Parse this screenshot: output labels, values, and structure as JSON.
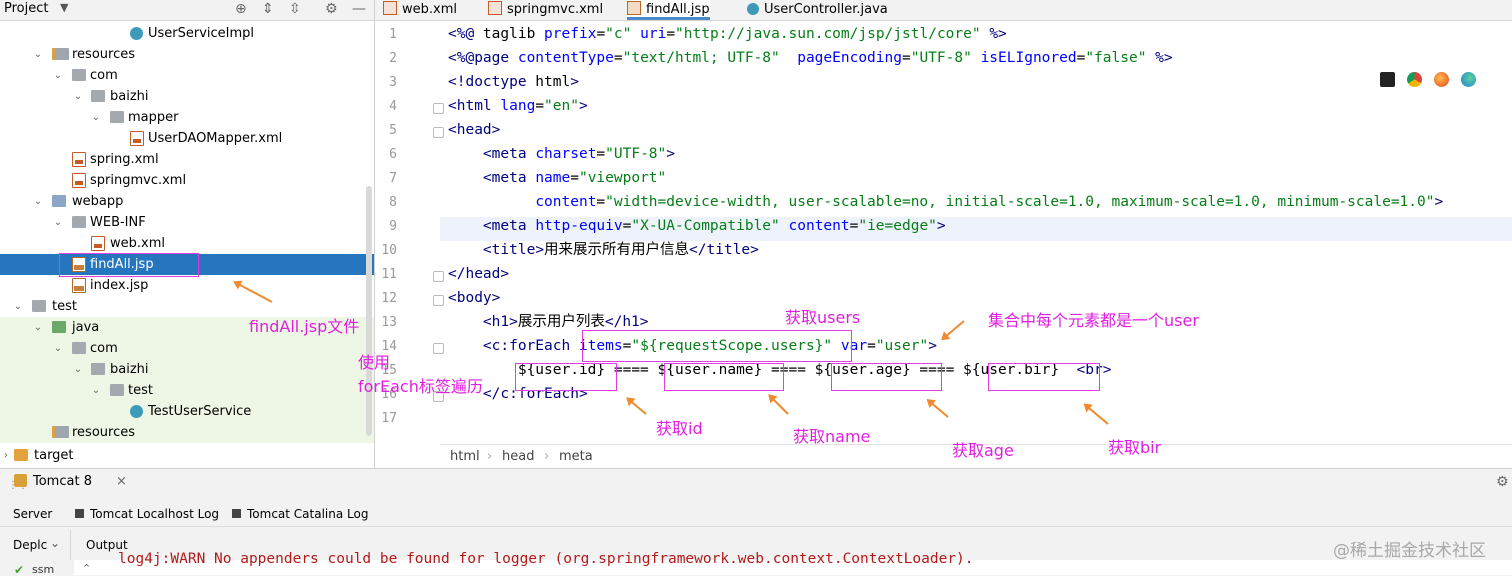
{
  "project_panel": {
    "title": "Project",
    "tree": [
      {
        "label": "UserServiceImpl",
        "icon": "class-icon"
      },
      {
        "label": "resources",
        "icon": "resources-folder-icon"
      },
      {
        "label": "com",
        "icon": "folder-icon"
      },
      {
        "label": "baizhi",
        "icon": "folder-icon"
      },
      {
        "label": "mapper",
        "icon": "folder-icon"
      },
      {
        "label": "UserDAOMapper.xml",
        "icon": "xml-file-icon"
      },
      {
        "label": "spring.xml",
        "icon": "xml-file-icon"
      },
      {
        "label": "springmvc.xml",
        "icon": "xml-file-icon"
      },
      {
        "label": "webapp",
        "icon": "web-folder-icon"
      },
      {
        "label": "WEB-INF",
        "icon": "folder-icon"
      },
      {
        "label": "web.xml",
        "icon": "xml-file-icon"
      },
      {
        "label": "findAll.jsp",
        "icon": "jsp-file-icon",
        "selected": true
      },
      {
        "label": "index.jsp",
        "icon": "jsp-file-icon"
      },
      {
        "label": "test",
        "icon": "folder-icon"
      },
      {
        "label": "java",
        "icon": "test-source-folder-icon"
      },
      {
        "label": "com",
        "icon": "folder-icon"
      },
      {
        "label": "baizhi",
        "icon": "folder-icon"
      },
      {
        "label": "test",
        "icon": "folder-icon"
      },
      {
        "label": "TestUserService",
        "icon": "class-icon"
      },
      {
        "label": "resources",
        "icon": "resources-folder-icon"
      },
      {
        "label": "target",
        "icon": "target-folder-icon"
      }
    ]
  },
  "editor_tabs": [
    {
      "label": "web.xml",
      "icon": "xml-file-icon"
    },
    {
      "label": "springmvc.xml",
      "icon": "xml-file-icon"
    },
    {
      "label": "findAll.jsp",
      "icon": "jsp-file-icon",
      "active": true
    },
    {
      "label": "UserController.java",
      "icon": "class-icon"
    }
  ],
  "line_numbers": [
    "1",
    "2",
    "3",
    "4",
    "5",
    "6",
    "7",
    "8",
    "9",
    "10",
    "11",
    "12",
    "13",
    "14",
    "15",
    "16",
    "17"
  ],
  "code_lines": [
    "<%@ taglib prefix=\"c\" uri=\"http://java.sun.com/jsp/jstl/core\" %>",
    "<%@page contentType=\"text/html; UTF-8\"  pageEncoding=\"UTF-8\" isELIgnored=\"false\" %>",
    "<!doctype html>",
    "<html lang=\"en\">",
    "<head>",
    "    <meta charset=\"UTF-8\">",
    "    <meta name=\"viewport\"",
    "          content=\"width=device-width, user-scalable=no, initial-scale=1.0, maximum-scale=1.0, minimum-scale=1.0\">",
    "    <meta http-equiv=\"X-UA-Compatible\" content=\"ie=edge\">",
    "    <title>用来展示所有用户信息</title>",
    "</head>",
    "<body>",
    "    <h1>展示用户列表</h1>",
    "    <c:forEach items=\"${requestScope.users}\" var=\"user\">",
    "        ${user.id} ==== ${user.name} ==== ${user.age} ==== ${user.bir}  <br>",
    "    </c:forEach>",
    ""
  ],
  "breadcrumb": [
    "html",
    "head",
    "meta"
  ],
  "bottom_panel": {
    "run_tab": "Tomcat 8",
    "tabs": [
      "Server",
      "Tomcat Localhost Log",
      "Tomcat Catalina Log"
    ],
    "deploy_label": "Deplc",
    "output_label": "Output",
    "log_line": "log4j:WARN No appenders could be found for logger (org.springframework.web.context.ContextLoader)."
  },
  "annotations": {
    "findall_file": "findAll.jsp文件",
    "use_foreach_1": "使用",
    "use_foreach_2": "forEach标签遍历",
    "get_users": "获取users",
    "each_element": "集合中每个元素都是一个user",
    "get_id": "获取id",
    "get_name": "获取name",
    "get_age": "获取age",
    "get_bir": "获取bir"
  },
  "watermark": "@稀土掘金技术社区",
  "colors": {
    "selection": "#2675bf",
    "annotation": "#e020e0",
    "arrow": "#f08a2e",
    "tag": "#000080",
    "attr": "#0000ff",
    "string": "#067d17"
  }
}
